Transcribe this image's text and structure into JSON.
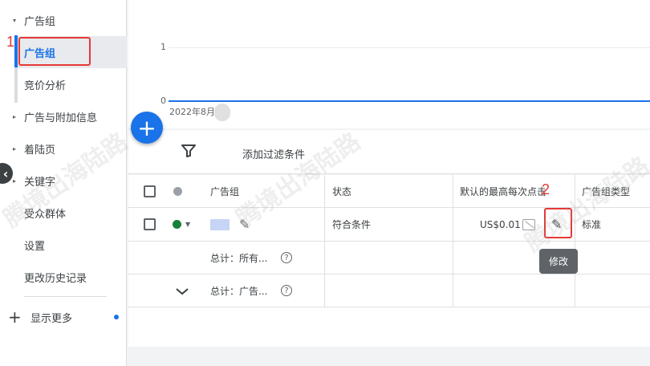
{
  "sidebar": {
    "items": [
      {
        "label": "广告组",
        "arrow": "▾"
      },
      {
        "label": "广告组"
      },
      {
        "label": "竞价分析"
      },
      {
        "label": "广告与附加信息",
        "arrow": "▸"
      },
      {
        "label": "着陆页",
        "arrow": "▸"
      },
      {
        "label": "关键字",
        "arrow": "▸"
      },
      {
        "label": "受众群体"
      },
      {
        "label": "设置"
      },
      {
        "label": "更改历史记录"
      }
    ],
    "show_more": "显示更多",
    "plus_icon": "+",
    "collapse_icon": "‹"
  },
  "annotations": {
    "step1": "1",
    "step2": "2"
  },
  "chart": {
    "y_ticks": [
      "1",
      "0"
    ],
    "x_tick": "2022年8月"
  },
  "fab_label": "+",
  "filter": {
    "label": "添加过滤条件"
  },
  "table": {
    "headers": {
      "name": "广告组",
      "status": "状态",
      "bid": "默认的最高每次点击",
      "type": "广告组类型"
    },
    "row": {
      "status": "符合条件",
      "bid": "US$0.01",
      "type": "标准"
    },
    "total_all": "总计：所有...",
    "total_group": "总计：广告...",
    "help_icon": "?",
    "chevron_icon": "⌄"
  },
  "tooltip": "修改",
  "watermark": "腾境出海陆路",
  "colors": {
    "accent": "#1a73e8",
    "annotation": "#e53935",
    "eligible": "#188038"
  }
}
